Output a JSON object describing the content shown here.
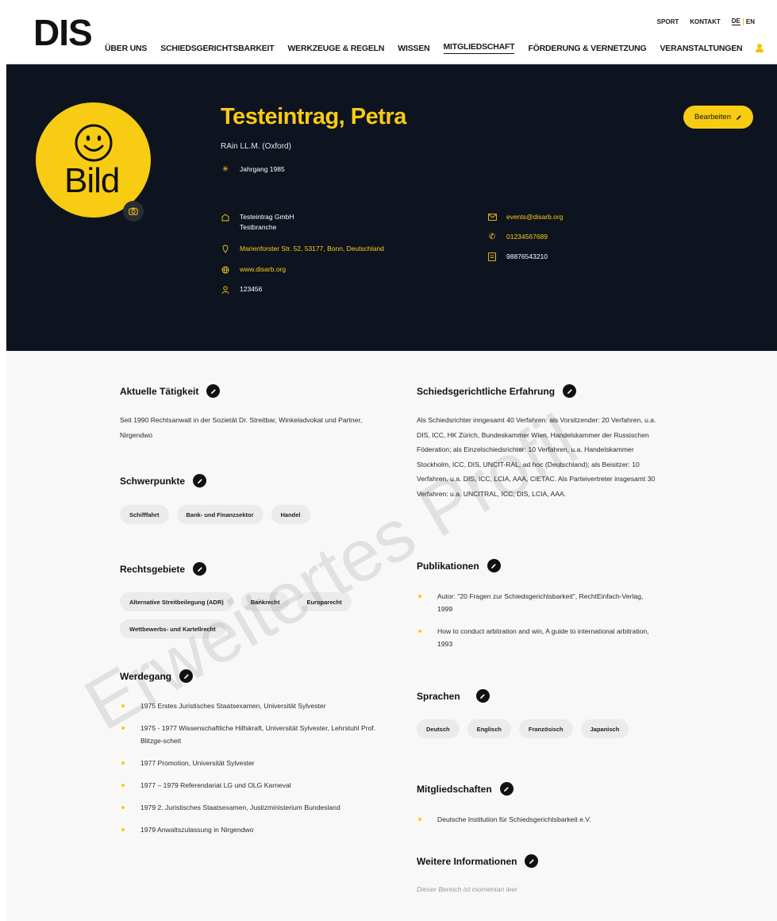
{
  "header": {
    "logo": "DIS",
    "top_links": {
      "sport": "SPORT",
      "kontakt": "KONTAKT",
      "lang_de": "DE",
      "lang_en": "EN"
    },
    "nav": [
      "ÜBER UNS",
      "SCHIEDSGERICHTSBARKEIT",
      "WERKZEUGE & REGELN",
      "WISSEN",
      "MITGLIEDSCHAFT",
      "FÖRDERUNG & VERNETZUNG",
      "VERANSTALTUNGEN"
    ],
    "active_nav": "MITGLIEDSCHAFT"
  },
  "profile": {
    "avatar_text": "Bild",
    "name": "Testeintrag, Petra",
    "title": "RAin LL.M. (Oxford)",
    "jahrgang": "Jahrgang 1985",
    "company": "Testeintrag GmbH",
    "branch": "Testbranche",
    "address": "Marienforster Str. 52, 53177, Bonn, Deutschland",
    "website": "www.disarb.org",
    "member_id": "123456",
    "email": "events@disarb.org",
    "phone": "01234567689",
    "fax": "98876543210",
    "edit_label": "Bearbeiten"
  },
  "sections": {
    "aktuelle_taetigkeit": {
      "title": "Aktuelle Tätigkeit",
      "text": "Seit 1990 Rechtsanwalt in der Sozietät Dr. Streitbar, Winkeladvokat und Partner, Nirgendwo"
    },
    "schwerpunkte": {
      "title": "Schwerpunkte",
      "chips": [
        "Schifffahrt",
        "Bank- und Finanzsektor",
        "Handel"
      ]
    },
    "rechtsgebiete": {
      "title": "Rechtsgebiete",
      "chips": [
        "Alternative Streitbeilegung (ADR)",
        "Bankrecht",
        "Europarecht",
        "Wettbewerbs- und Kartellrecht"
      ]
    },
    "werdegang": {
      "title": "Werdegang",
      "items": [
        "1975 Erstes Juristisches Staatsexamen, Universität Sylvester",
        "1975 - 1977 Wissenschaftliche Hilfskraft, Universität Sylvester, Lehrstuhl Prof. Blitzge-scheit",
        "1977 Promotion, Universität Sylvester",
        "1977 – 1979 Referendariat LG und OLG Karneval",
        "1979 2. Juristisches Staatsexamen, Justizministerium Bundesland",
        "1979 Anwaltszulassung in Nirgendwo"
      ]
    },
    "schiedsgerichtliche_erfahrung": {
      "title": "Schiedsgerichtliche Erfahrung",
      "text": "Als Schiedsrichter inngesamt 40 Verfahren: als Vorsitzender: 20 Verfahren, u.a. DIS, ICC, HK Zürich, Bundeskammer Wien, Handelskammer der Russischen Föderation; als Einzelschiedsrichter: 10 Verfahren, u.a. Handelskammer Stockholm, ICC, DIS, UNCIT-RAL, ad hoc (Deutschland); als Beisitzer: 10 Verfahren, u.a. DIS, ICC, LCIA, AAA, CIETAC. Als Parteivertreter insgesamt 30 Verfahren: u.a. UNCITRAL, ICC; DIS, LCIA, AAA."
    },
    "publikationen": {
      "title": "Publikationen",
      "items": [
        "Autor: \"20 Fragen zur Schiedsgerichtsbarkeit\", RechtEinfach-Verlag, 1999",
        "How to conduct arbitration and win, A guide to international arbitration, 1993"
      ]
    },
    "sprachen": {
      "title": "Sprachen",
      "chips": [
        "Deutsch",
        "Englisch",
        "Französisch",
        "Japanisch"
      ]
    },
    "mitgliedschaften": {
      "title": "Mitgliedschaften",
      "items": [
        "Deutsche Institution für Schiedsgerichtsbarkeit e.V."
      ]
    },
    "weitere_informationen": {
      "title": "Weitere Informationen",
      "empty_text": "Dieser Bereich ist momentan leer"
    }
  },
  "watermark": "Erweitertes Profil",
  "colors": {
    "accent": "#f8cc13",
    "hero_bg": "#0e1320",
    "content_bg": "#f8f8f8"
  }
}
